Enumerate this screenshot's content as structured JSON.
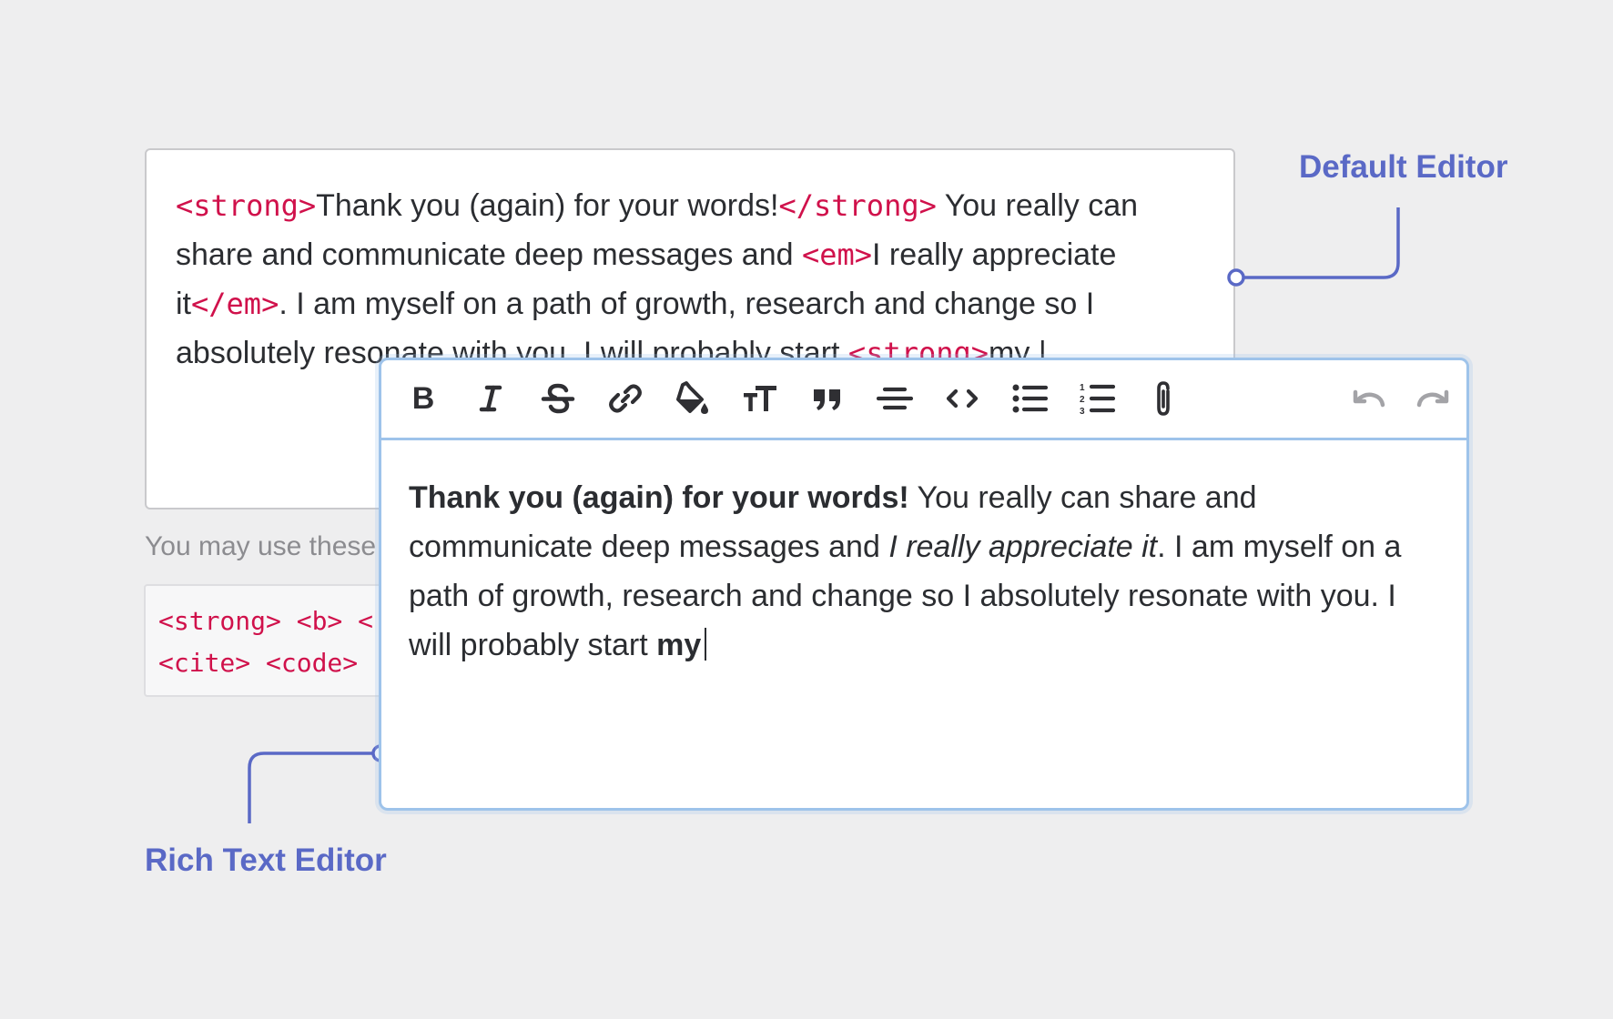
{
  "labels": {
    "default_editor": "Default Editor",
    "rich_text_editor": "Rich Text Editor"
  },
  "default_editor": {
    "segments": [
      {
        "type": "tag",
        "text": "<strong>"
      },
      {
        "type": "text",
        "text": "Thank you (again) for your words!"
      },
      {
        "type": "tag",
        "text": "</strong>"
      },
      {
        "type": "text",
        "text": " You really can share and communicate deep messages and "
      },
      {
        "type": "tag",
        "text": "<em>"
      },
      {
        "type": "text",
        "text": "I really appreciate it"
      },
      {
        "type": "tag",
        "text": "</em>"
      },
      {
        "type": "text",
        "text": ". I am myself on a path of growth, research and change so I absolutely resonate with you. I will probably start "
      },
      {
        "type": "tag",
        "text": "<strong>"
      },
      {
        "type": "text",
        "text": "my |"
      }
    ],
    "hint": "You may use these",
    "allowed_tags_line1": "<strong> <b> <",
    "allowed_tags_line2": "<cite> <code>"
  },
  "rich_editor": {
    "toolbar": [
      {
        "icon": "bold-icon",
        "tooltip": "Bold"
      },
      {
        "icon": "italic-icon",
        "tooltip": "Italic"
      },
      {
        "icon": "strikethrough-icon",
        "tooltip": "Strikethrough"
      },
      {
        "icon": "link-icon",
        "tooltip": "Link"
      },
      {
        "icon": "fill-color-icon",
        "tooltip": "Highlight"
      },
      {
        "icon": "text-size-icon",
        "tooltip": "Heading"
      },
      {
        "icon": "quote-icon",
        "tooltip": "Quote"
      },
      {
        "icon": "align-center-icon",
        "tooltip": "Align"
      },
      {
        "icon": "code-icon",
        "tooltip": "Code"
      },
      {
        "icon": "bullet-list-icon",
        "tooltip": "Bullet list"
      },
      {
        "icon": "numbered-list-icon",
        "tooltip": "Numbered list"
      },
      {
        "icon": "attachment-icon",
        "tooltip": "Attach"
      },
      {
        "icon": "undo-icon",
        "tooltip": "Undo"
      },
      {
        "icon": "redo-icon",
        "tooltip": "Redo"
      }
    ],
    "content": {
      "bold_1": "Thank you (again) for your words!",
      "text_1": " You really can share and communicate deep messages and ",
      "italic_1": "I really appreciate it",
      "text_2": ". I am myself on a path of growth, research and change so I absolutely resonate with you. I will probably start ",
      "bold_2": "my"
    }
  },
  "colors": {
    "accent": "#5a69c6",
    "tag": "#d0114b",
    "editor_border": "#9ec3ea",
    "background": "#eeeeef"
  }
}
